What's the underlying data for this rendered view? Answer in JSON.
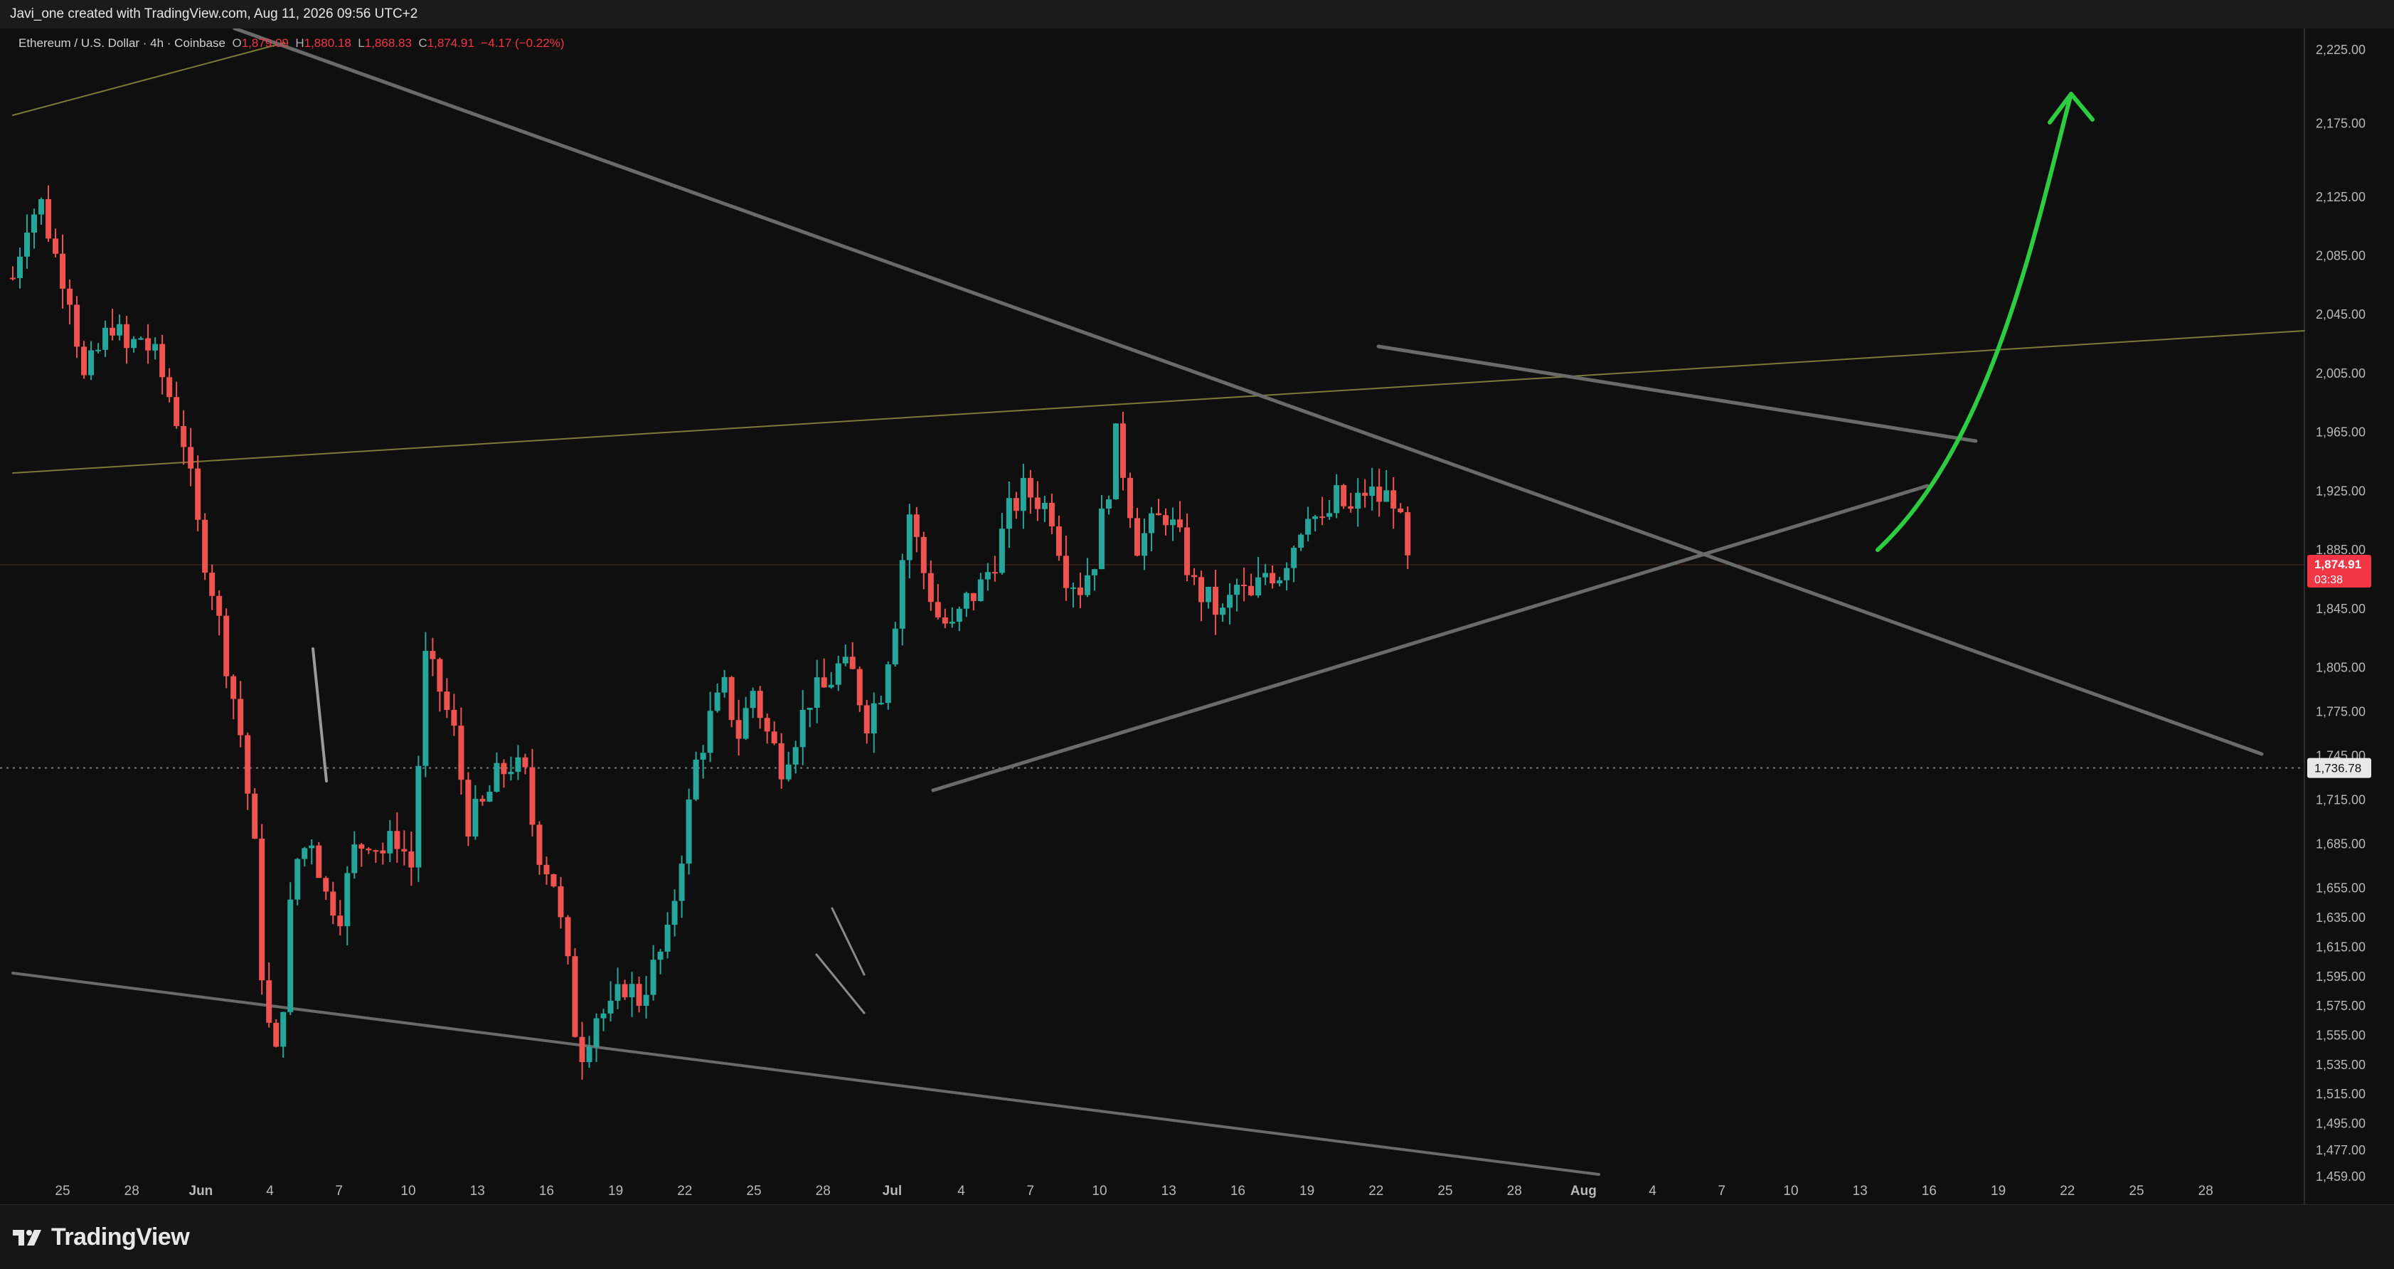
{
  "header": {
    "attribution": "Javi_one created with TradingView.com, Aug 11, 2026 09:56 UTC+2"
  },
  "legend": {
    "symbol": "Ethereum / U.S. Dollar · 4h · Coinbase",
    "o_label": "O",
    "o_value": "1,879.09",
    "h_label": "H",
    "h_value": "1,880.18",
    "l_label": "L",
    "l_value": "1,868.83",
    "c_label": "C",
    "c_value": "1,874.91",
    "change": "−4.17 (−0.22%)"
  },
  "brand": {
    "name": "TradingView"
  },
  "colors": {
    "up": "#26a69a",
    "down": "#ef5350",
    "background": "#0f0f0f",
    "trendline": "#6a6a6a",
    "forecast_arrow": "#2ecc40",
    "olive_line": "#7a7a3a",
    "price_badge": "#f23645"
  },
  "chart_data": {
    "type": "candlestick",
    "symbol": "ETH/USD",
    "interval": "4h",
    "price_scale": {
      "ticks": [
        "2,225.00",
        "2,175.00",
        "2,125.00",
        "2,085.00",
        "2,045.00",
        "2,005.00",
        "1,965.00",
        "1,925.00",
        "1,885.00",
        "1,845.00",
        "1,805.00",
        "1,775.00",
        "1,745.00",
        "1,715.00",
        "1,685.00",
        "1,655.00",
        "1,635.00",
        "1,615.00",
        "1,595.00",
        "1,575.00",
        "1,555.00",
        "1,535.00",
        "1,515.00",
        "1,495.00",
        "1,477.00",
        "1,459.00"
      ],
      "ylim": [
        1450,
        2240
      ]
    },
    "time_axis": {
      "labels": [
        "25",
        "28",
        "Jun",
        "4",
        "7",
        "10",
        "13",
        "16",
        "19",
        "22",
        "25",
        "28",
        "Jul",
        "4",
        "7",
        "10",
        "13",
        "16",
        "19",
        "22",
        "25",
        "28",
        "Aug",
        "4",
        "7",
        "10",
        "13",
        "16",
        "19",
        "22",
        "25",
        "28"
      ],
      "bold": [
        "Jun",
        "Jul",
        "Aug"
      ]
    },
    "last_price": {
      "value": "1,874.91",
      "countdown": "03:38"
    },
    "crosshair_price": "1,736.78",
    "price_path": [
      [
        0,
        2070
      ],
      [
        2,
        2110
      ],
      [
        4,
        2120
      ],
      [
        6,
        2085
      ],
      [
        8,
        2060
      ],
      [
        10,
        2000
      ],
      [
        12,
        2020
      ],
      [
        14,
        2040
      ],
      [
        16,
        2020
      ],
      [
        18,
        2030
      ],
      [
        20,
        2015
      ],
      [
        22,
        1990
      ],
      [
        24,
        1960
      ],
      [
        26,
        1900
      ],
      [
        28,
        1860
      ],
      [
        30,
        1810
      ],
      [
        32,
        1760
      ],
      [
        33,
        1720
      ],
      [
        34,
        1680
      ],
      [
        35,
        1600
      ],
      [
        36,
        1560
      ],
      [
        37,
        1540
      ],
      [
        38,
        1580
      ],
      [
        39,
        1640
      ],
      [
        40,
        1675
      ],
      [
        42,
        1690
      ],
      [
        44,
        1650
      ],
      [
        46,
        1640
      ],
      [
        48,
        1680
      ],
      [
        50,
        1690
      ],
      [
        52,
        1680
      ],
      [
        54,
        1690
      ],
      [
        56,
        1670
      ],
      [
        57,
        1740
      ],
      [
        58,
        1810
      ],
      [
        59,
        1800
      ],
      [
        60,
        1790
      ],
      [
        62,
        1760
      ],
      [
        64,
        1700
      ],
      [
        66,
        1710
      ],
      [
        68,
        1730
      ],
      [
        70,
        1740
      ],
      [
        72,
        1730
      ],
      [
        73,
        1700
      ],
      [
        74,
        1680
      ],
      [
        76,
        1660
      ],
      [
        78,
        1600
      ],
      [
        79,
        1560
      ],
      [
        80,
        1545
      ],
      [
        82,
        1570
      ],
      [
        84,
        1570
      ],
      [
        86,
        1590
      ],
      [
        88,
        1580
      ],
      [
        90,
        1600
      ],
      [
        92,
        1620
      ],
      [
        93,
        1650
      ],
      [
        94,
        1680
      ],
      [
        95,
        1710
      ],
      [
        96,
        1740
      ],
      [
        98,
        1770
      ],
      [
        100,
        1790
      ],
      [
        102,
        1760
      ],
      [
        104,
        1790
      ],
      [
        106,
        1760
      ],
      [
        108,
        1740
      ],
      [
        110,
        1760
      ],
      [
        112,
        1785
      ],
      [
        114,
        1790
      ],
      [
        116,
        1805
      ],
      [
        118,
        1800
      ],
      [
        120,
        1770
      ],
      [
        122,
        1790
      ],
      [
        124,
        1840
      ],
      [
        125,
        1880
      ],
      [
        126,
        1910
      ],
      [
        128,
        1870
      ],
      [
        130,
        1840
      ],
      [
        132,
        1830
      ],
      [
        134,
        1850
      ],
      [
        136,
        1860
      ],
      [
        138,
        1880
      ],
      [
        140,
        1910
      ],
      [
        142,
        1925
      ],
      [
        144,
        1920
      ],
      [
        146,
        1910
      ],
      [
        148,
        1870
      ],
      [
        150,
        1860
      ],
      [
        152,
        1880
      ],
      [
        154,
        1930
      ],
      [
        155,
        1960
      ],
      [
        156,
        1940
      ],
      [
        158,
        1890
      ],
      [
        160,
        1900
      ],
      [
        162,
        1910
      ],
      [
        164,
        1890
      ],
      [
        166,
        1860
      ],
      [
        168,
        1850
      ],
      [
        170,
        1840
      ],
      [
        172,
        1860
      ],
      [
        174,
        1850
      ],
      [
        176,
        1870
      ],
      [
        178,
        1870
      ],
      [
        180,
        1890
      ],
      [
        182,
        1915
      ],
      [
        184,
        1900
      ],
      [
        186,
        1920
      ],
      [
        188,
        1910
      ],
      [
        190,
        1925
      ],
      [
        192,
        1920
      ],
      [
        194,
        1922
      ],
      [
        195,
        1900
      ],
      [
        196,
        1875
      ]
    ],
    "last_index": 196,
    "forecast": {
      "direction": "up",
      "from": 1885,
      "to": 2195
    }
  }
}
